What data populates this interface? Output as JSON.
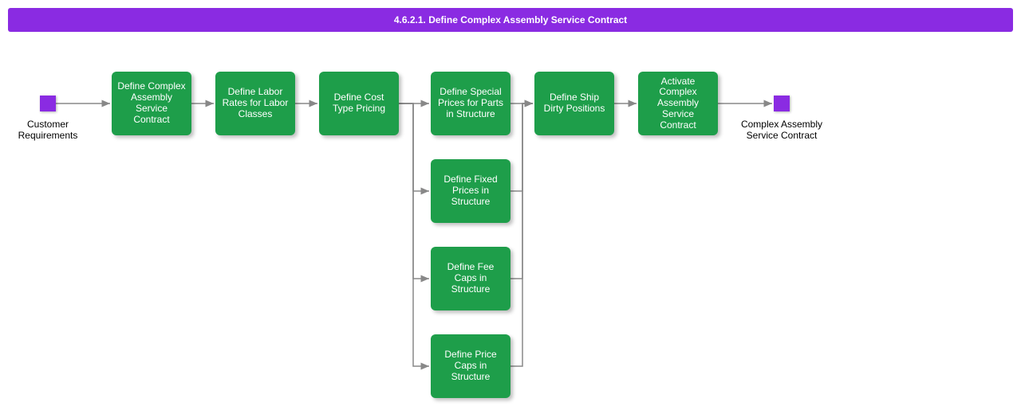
{
  "title": "4.6.2.1. Define Complex Assembly Service Contract",
  "colors": {
    "accent_purple": "#8a2be2",
    "node_green": "#1e9e4a",
    "arrow_gray": "#888888"
  },
  "events": {
    "start": {
      "label": "Customer\nRequirements"
    },
    "end": {
      "label": "Complex Assembly\nService Contract"
    }
  },
  "nodes": {
    "n1": {
      "label": "Define Complex Assembly Service Contract"
    },
    "n2": {
      "label": "Define Labor Rates for Labor Classes"
    },
    "n3": {
      "label": "Define Cost Type Pricing"
    },
    "n4a": {
      "label": "Define Special Prices for Parts in Structure"
    },
    "n4b": {
      "label": "Define Fixed Prices in Structure"
    },
    "n4c": {
      "label": "Define Fee Caps in Structure"
    },
    "n4d": {
      "label": "Define Price Caps in Structure"
    },
    "n5": {
      "label": "Define Ship Dirty Positions"
    },
    "n6": {
      "label": "Activate Complex Assembly Service Contract"
    }
  },
  "chart_data": {
    "type": "diagram",
    "title": "4.6.2.1. Define Complex Assembly Service Contract",
    "nodes": [
      {
        "id": "start",
        "kind": "event",
        "label": "Customer Requirements"
      },
      {
        "id": "n1",
        "kind": "task",
        "label": "Define Complex Assembly Service Contract"
      },
      {
        "id": "n2",
        "kind": "task",
        "label": "Define Labor Rates for Labor Classes"
      },
      {
        "id": "n3",
        "kind": "task",
        "label": "Define Cost Type Pricing"
      },
      {
        "id": "n4a",
        "kind": "task",
        "label": "Define Special Prices for Parts in Structure"
      },
      {
        "id": "n4b",
        "kind": "task",
        "label": "Define Fixed Prices in Structure"
      },
      {
        "id": "n4c",
        "kind": "task",
        "label": "Define Fee Caps in Structure"
      },
      {
        "id": "n4d",
        "kind": "task",
        "label": "Define Price Caps in Structure"
      },
      {
        "id": "n5",
        "kind": "task",
        "label": "Define Ship Dirty Positions"
      },
      {
        "id": "n6",
        "kind": "task",
        "label": "Activate Complex Assembly Service Contract"
      },
      {
        "id": "end",
        "kind": "event",
        "label": "Complex Assembly Service Contract"
      }
    ],
    "edges": [
      [
        "start",
        "n1"
      ],
      [
        "n1",
        "n2"
      ],
      [
        "n2",
        "n3"
      ],
      [
        "n3",
        "n4a"
      ],
      [
        "n3",
        "n4b"
      ],
      [
        "n3",
        "n4c"
      ],
      [
        "n3",
        "n4d"
      ],
      [
        "n4a",
        "n5"
      ],
      [
        "n4b",
        "n5"
      ],
      [
        "n4c",
        "n5"
      ],
      [
        "n4d",
        "n5"
      ],
      [
        "n5",
        "n6"
      ],
      [
        "n6",
        "end"
      ]
    ]
  }
}
